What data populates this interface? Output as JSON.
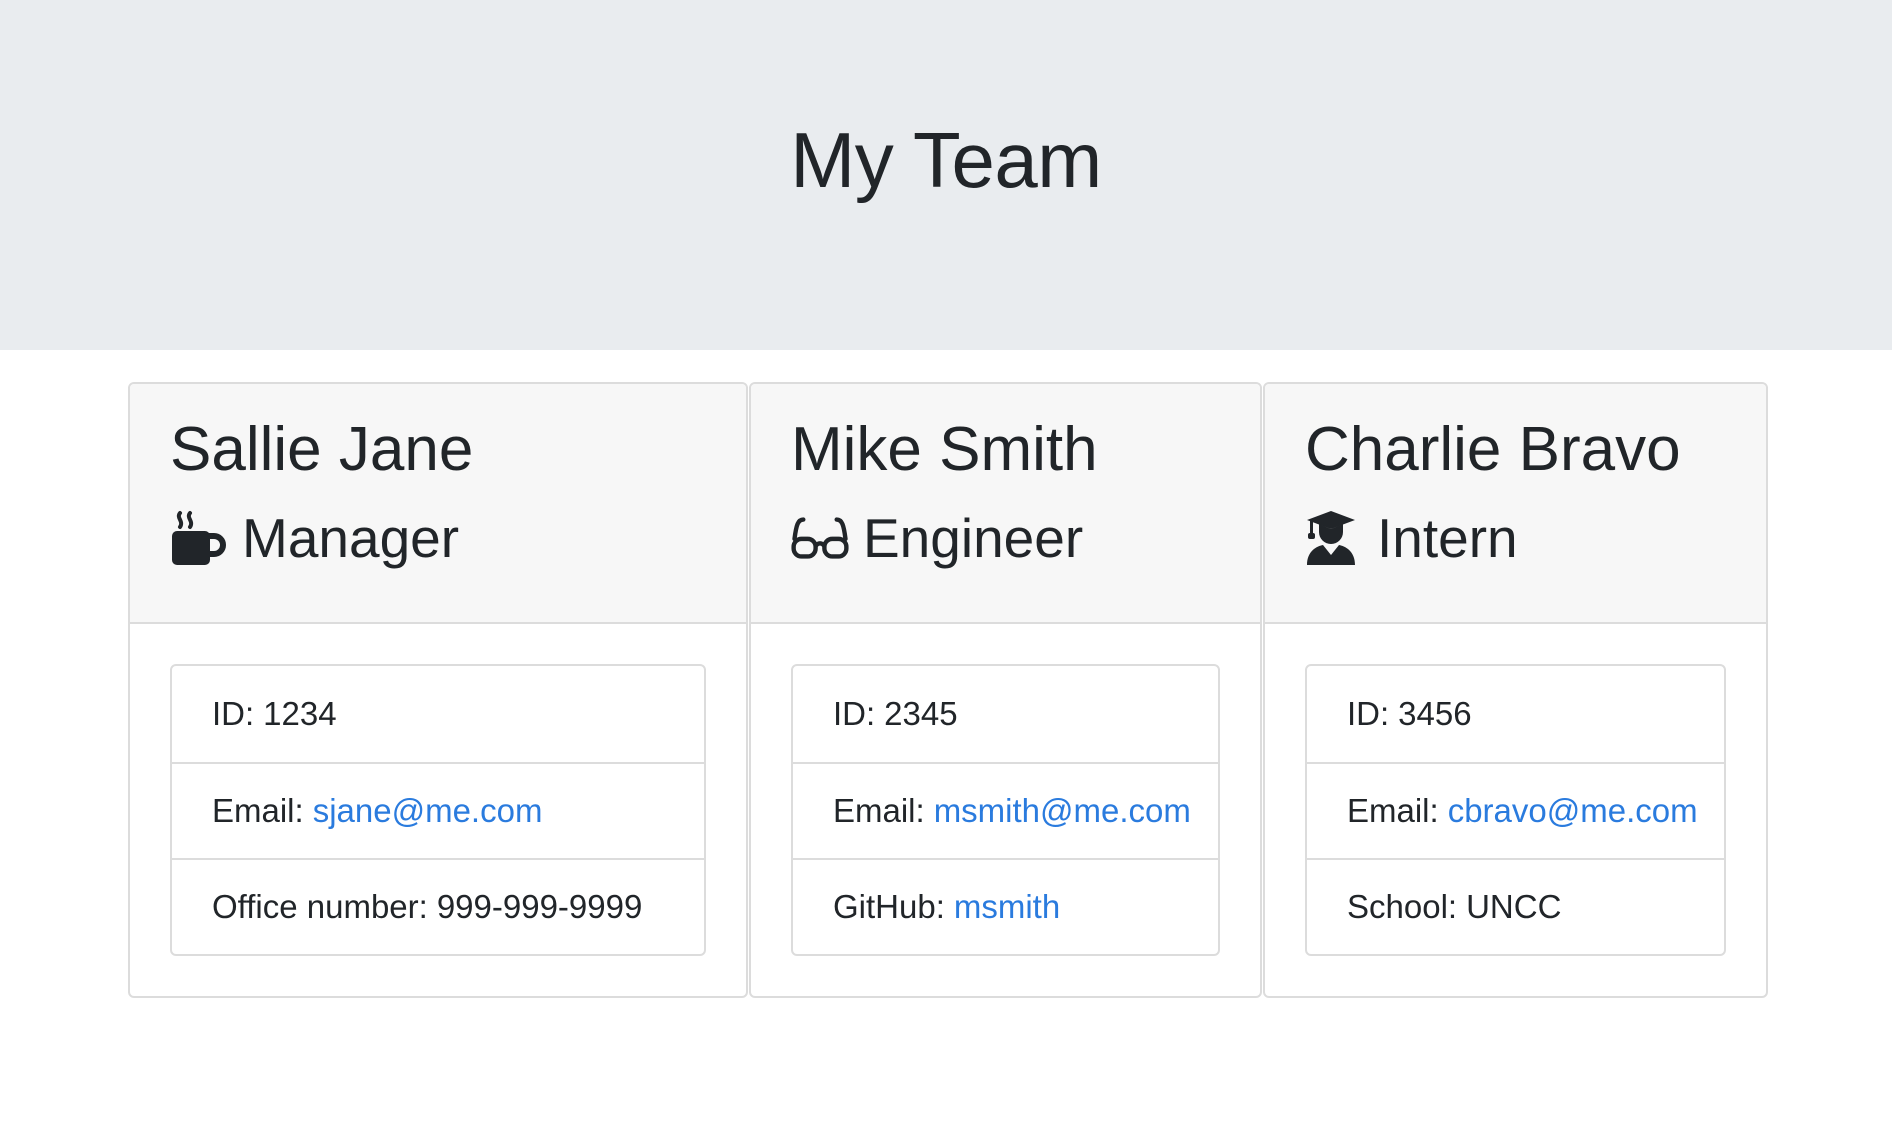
{
  "page": {
    "title": "My Team"
  },
  "team": [
    {
      "name": "Sallie Jane",
      "role": "Manager",
      "icon": "coffee-mug-icon",
      "id_label": "ID:",
      "id_value": "1234",
      "email_label": "Email:",
      "email": "sjane@me.com",
      "extra_label": "Office number:",
      "extra_value": "999-999-9999"
    },
    {
      "name": "Mike Smith",
      "role": "Engineer",
      "icon": "glasses-icon",
      "id_label": "ID:",
      "id_value": "2345",
      "email_label": "Email:",
      "email": "msmith@me.com",
      "extra_label": "GitHub:",
      "extra_value": "msmith"
    },
    {
      "name": "Charlie Bravo",
      "role": "Intern",
      "icon": "graduate-icon",
      "id_label": "ID:",
      "id_value": "3456",
      "email_label": "Email:",
      "email": "cbravo@me.com",
      "extra_label": "School:",
      "extra_value": "UNCC"
    }
  ],
  "colors": {
    "header_bg": "#e9ecef",
    "card_header_bg": "#f7f7f7",
    "link": "#2a7bde",
    "text": "#212529",
    "border": "#dcdcdc"
  }
}
